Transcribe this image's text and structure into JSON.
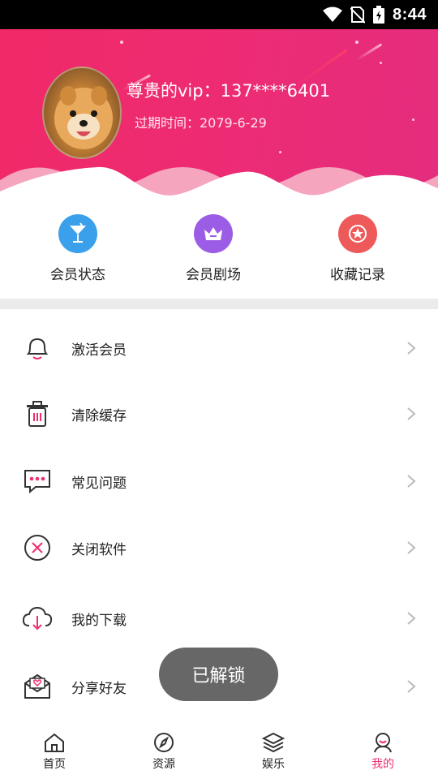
{
  "status_bar": {
    "time": "8:44"
  },
  "profile": {
    "username": "尊贵的vip：137****6401",
    "expire_text": "过期时间：2079-6-29"
  },
  "quick_actions": [
    {
      "label": "会员状态",
      "icon": "cocktail-icon",
      "color": "#3aa0ec"
    },
    {
      "label": "会员剧场",
      "icon": "crown-icon",
      "color": "#9b5de5"
    },
    {
      "label": "收藏记录",
      "icon": "star-icon",
      "color": "#ee5a5a"
    }
  ],
  "menu": [
    {
      "label": "激活会员",
      "icon": "bell-icon"
    },
    {
      "label": "清除缓存",
      "icon": "trash-icon"
    },
    {
      "label": "常见问题",
      "icon": "chat-bubble-icon"
    },
    {
      "label": "关闭软件",
      "icon": "close-circle-icon"
    },
    {
      "label": "我的下载",
      "icon": "cloud-download-icon"
    },
    {
      "label": "分享好友",
      "icon": "share-envelope-icon"
    }
  ],
  "toast": {
    "text": "已解锁"
  },
  "bottom_nav": [
    {
      "label": "首页",
      "icon": "home-icon",
      "active": false
    },
    {
      "label": "资源",
      "icon": "compass-icon",
      "active": false
    },
    {
      "label": "娱乐",
      "icon": "layers-icon",
      "active": false
    },
    {
      "label": "我的",
      "icon": "user-icon",
      "active": true
    }
  ],
  "colors": {
    "accent": "#ef2f6c",
    "header_start": "#f02a67",
    "header_end": "#e42d7e"
  }
}
